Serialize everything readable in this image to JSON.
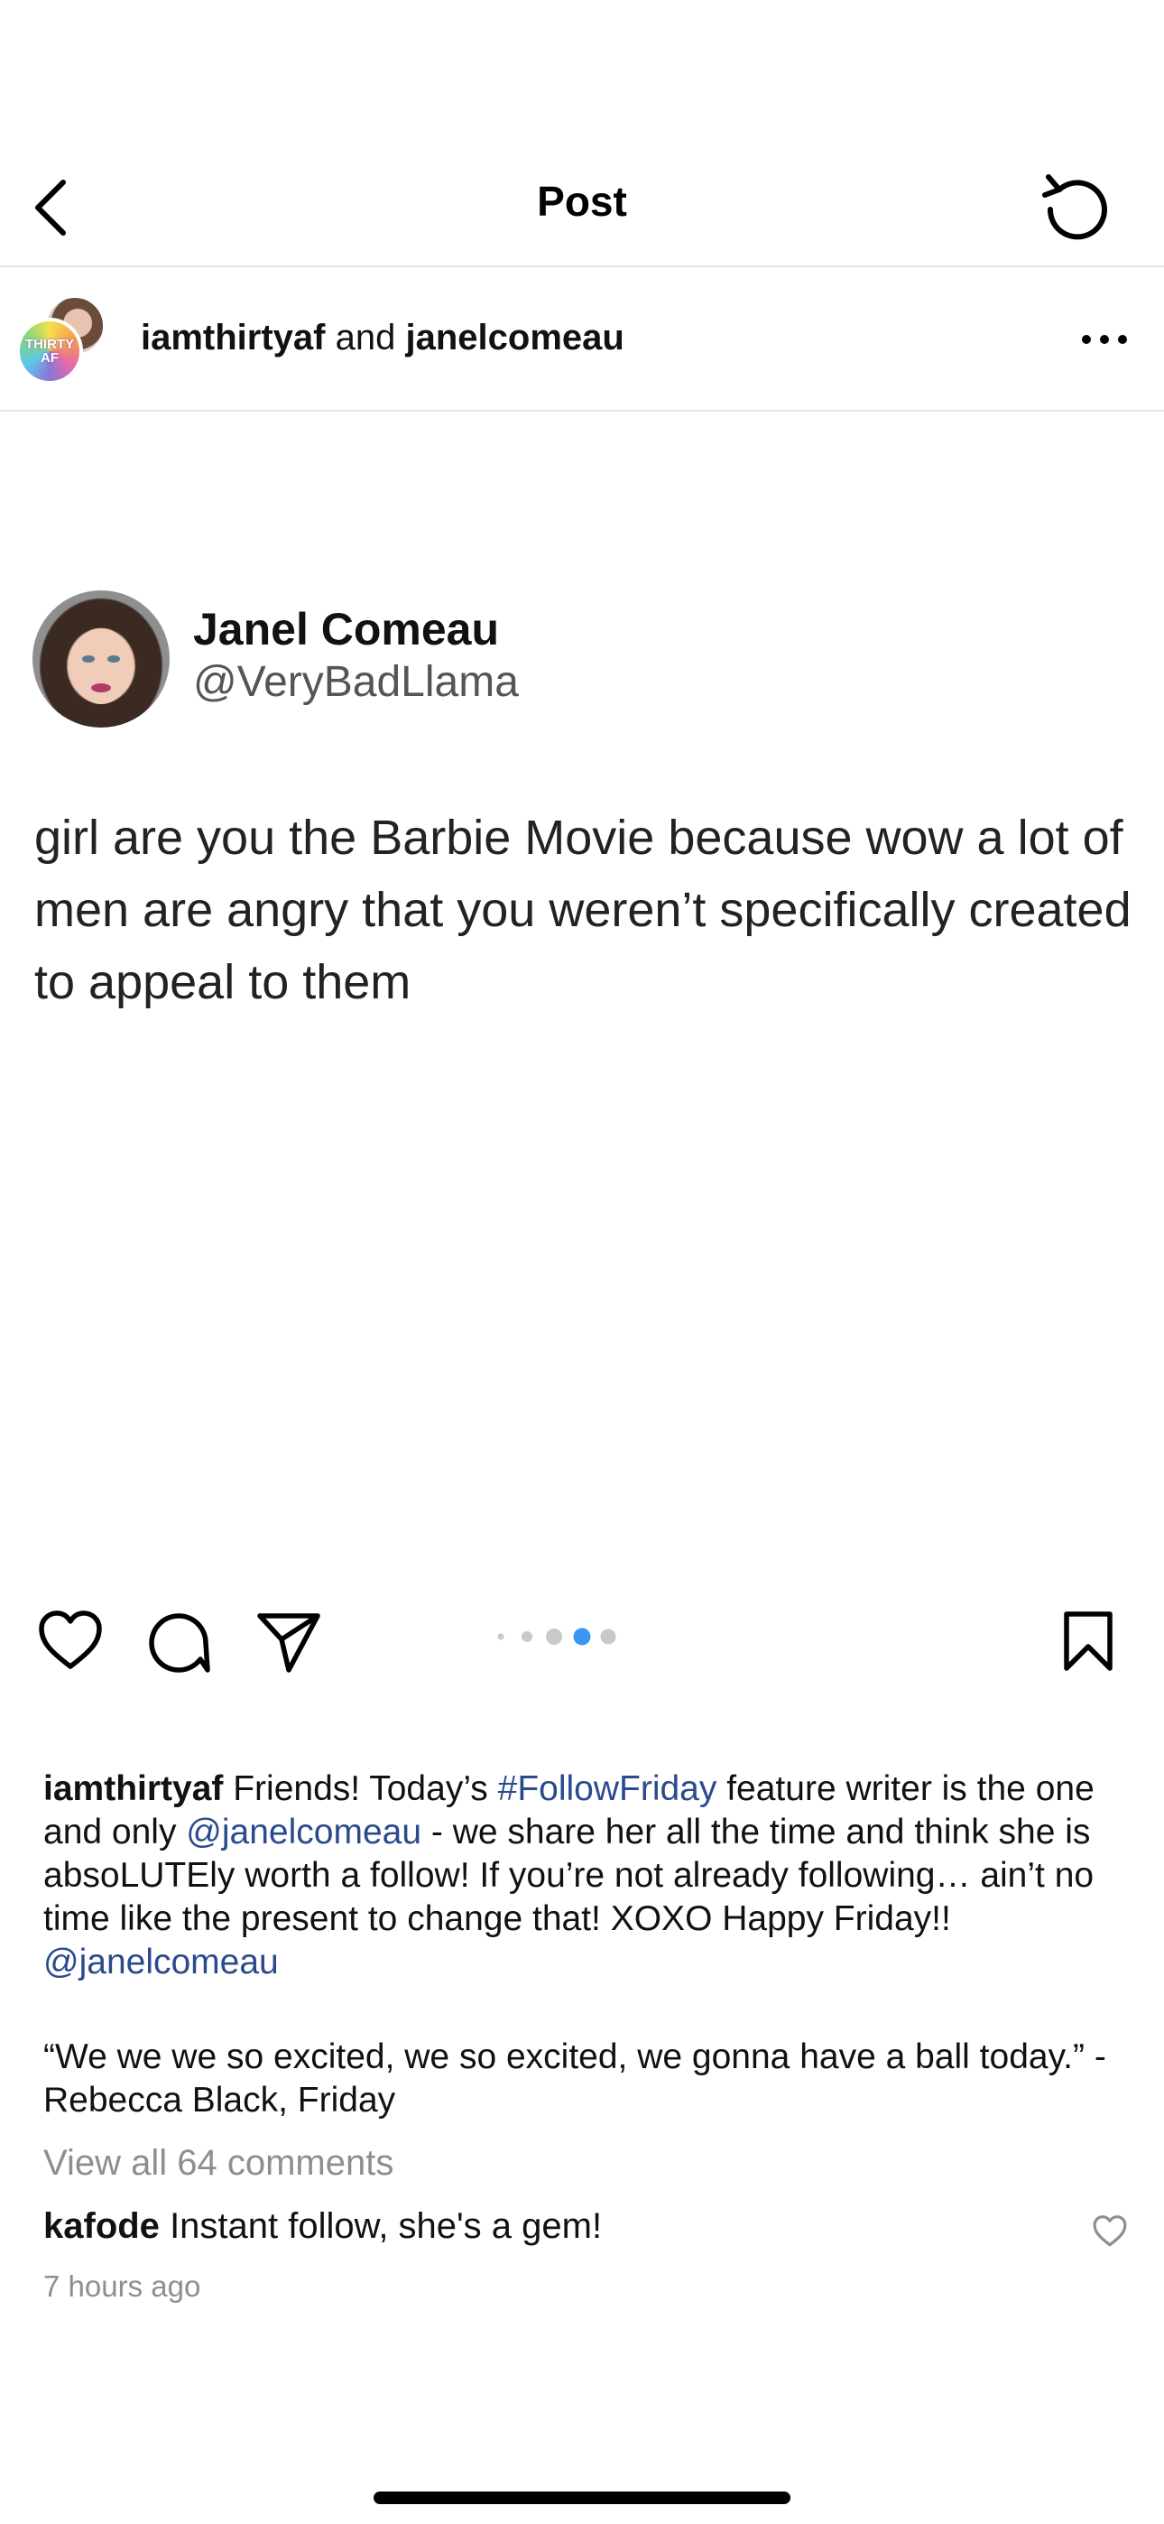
{
  "nav": {
    "title": "Post",
    "back_icon": "chevron-left-icon",
    "refresh_icon": "refresh-icon"
  },
  "post_header": {
    "user1": "iamthirtyaf",
    "joiner": "and",
    "user2": "janelcomeau",
    "avatar_front_label": "THIRTY AF",
    "more_icon": "ellipsis-icon"
  },
  "tweet": {
    "name": "Janel Comeau",
    "handle": "@VeryBadLlama",
    "text": "girl are you the Barbie Movie because wow a lot of men are angry that you weren’t specifically created to appeal to them"
  },
  "actions": {
    "like_icon": "heart-icon",
    "comment_icon": "comment-icon",
    "share_icon": "send-icon",
    "save_icon": "bookmark-icon",
    "carousel_active_index": 3,
    "carousel_count": 5,
    "active_color": "#3897f0"
  },
  "caption": {
    "username": "iamthirtyaf",
    "part1": "Friends! Today’s",
    "hashtag": "#FollowFriday",
    "part2": "feature writer is the one and only",
    "mention1": "@janelcomeau",
    "part3": "- we share her all the time and think she is absoLUTEly worth a follow! If you’re not already following… ain’t no time like the present to change that! XOXO Happy Friday!!",
    "mention2": "@janelcomeau",
    "quote": "“We we we so excited, we so excited, we gonna have a ball today.” -Rebecca Black, Friday"
  },
  "comments": {
    "view_all": "View all 64 comments",
    "first_user": "kafode",
    "first_text": "Instant follow, she's a gem!",
    "timestamp": "7 hours ago"
  }
}
